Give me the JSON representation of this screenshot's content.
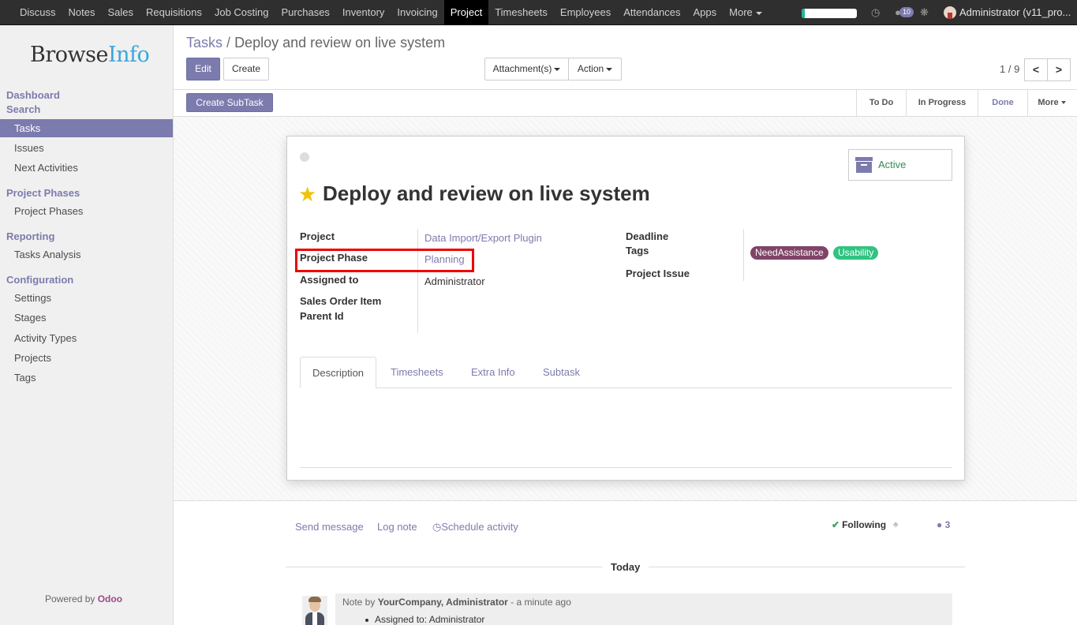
{
  "topbar": {
    "menu": [
      "Discuss",
      "Notes",
      "Sales",
      "Requisitions",
      "Job Costing",
      "Purchases",
      "Inventory",
      "Invoicing",
      "Project",
      "Timesheets",
      "Employees",
      "Attendances",
      "Apps",
      "More"
    ],
    "active": "Project",
    "progress": 0.05,
    "message_count": "10",
    "user": "Administrator (v11_pro..."
  },
  "sidebar": {
    "logo_browse": "Browse",
    "logo_info": "Info",
    "sections": {
      "dashboard": "Dashboard",
      "search": "Search",
      "project_phases": "Project Phases",
      "reporting": "Reporting",
      "configuration": "Configuration"
    },
    "items": {
      "tasks": "Tasks",
      "issues": "Issues",
      "next_activities": "Next Activities",
      "project_phases": "Project Phases",
      "tasks_analysis": "Tasks Analysis",
      "settings": "Settings",
      "stages": "Stages",
      "activity_types": "Activity Types",
      "projects": "Projects",
      "tags": "Tags"
    },
    "powered_by": "Powered by",
    "powered_odoo": "Odoo"
  },
  "breadcrumb": {
    "parent": "Tasks",
    "separator": "/",
    "current": "Deploy and review on live system"
  },
  "buttons": {
    "edit": "Edit",
    "create": "Create",
    "attachments": "Attachment(s)",
    "action": "Action",
    "create_subtask": "Create SubTask"
  },
  "pager": {
    "value": "1 / 9",
    "prev": "<",
    "next": ">"
  },
  "stages": {
    "todo": "To Do",
    "in_progress": "In Progress",
    "done": "Done",
    "more": "More"
  },
  "task": {
    "status": "Active",
    "title": "Deploy and review on live system",
    "fields": {
      "project_label": "Project",
      "project_value": "Data Import/Export Plugin",
      "phase_label": "Project Phase",
      "phase_value": "Planning",
      "assigned_label": "Assigned to",
      "assigned_value": "Administrator",
      "so_item_label": "Sales Order Item",
      "parent_label": "Parent Id",
      "deadline_label": "Deadline",
      "tags_label": "Tags",
      "issue_label": "Project Issue"
    },
    "tags": [
      {
        "label": "NeedAssistance",
        "color": "#7f4468"
      },
      {
        "label": "Usability",
        "color": "#30c381"
      }
    ],
    "tabs": [
      "Description",
      "Timesheets",
      "Extra Info",
      "Subtask"
    ]
  },
  "chatter": {
    "send_message": "Send message",
    "log_note": "Log note",
    "schedule_activity": "Schedule activity",
    "following": "Following",
    "followers": "3",
    "today": "Today",
    "message": {
      "prefix": "Note by",
      "author": "YourCompany, Administrator",
      "time": "- a minute ago",
      "body": "Assigned to: Administrator"
    }
  },
  "colors": {
    "accent": "#7c7bad",
    "highlight": "#e00000"
  }
}
